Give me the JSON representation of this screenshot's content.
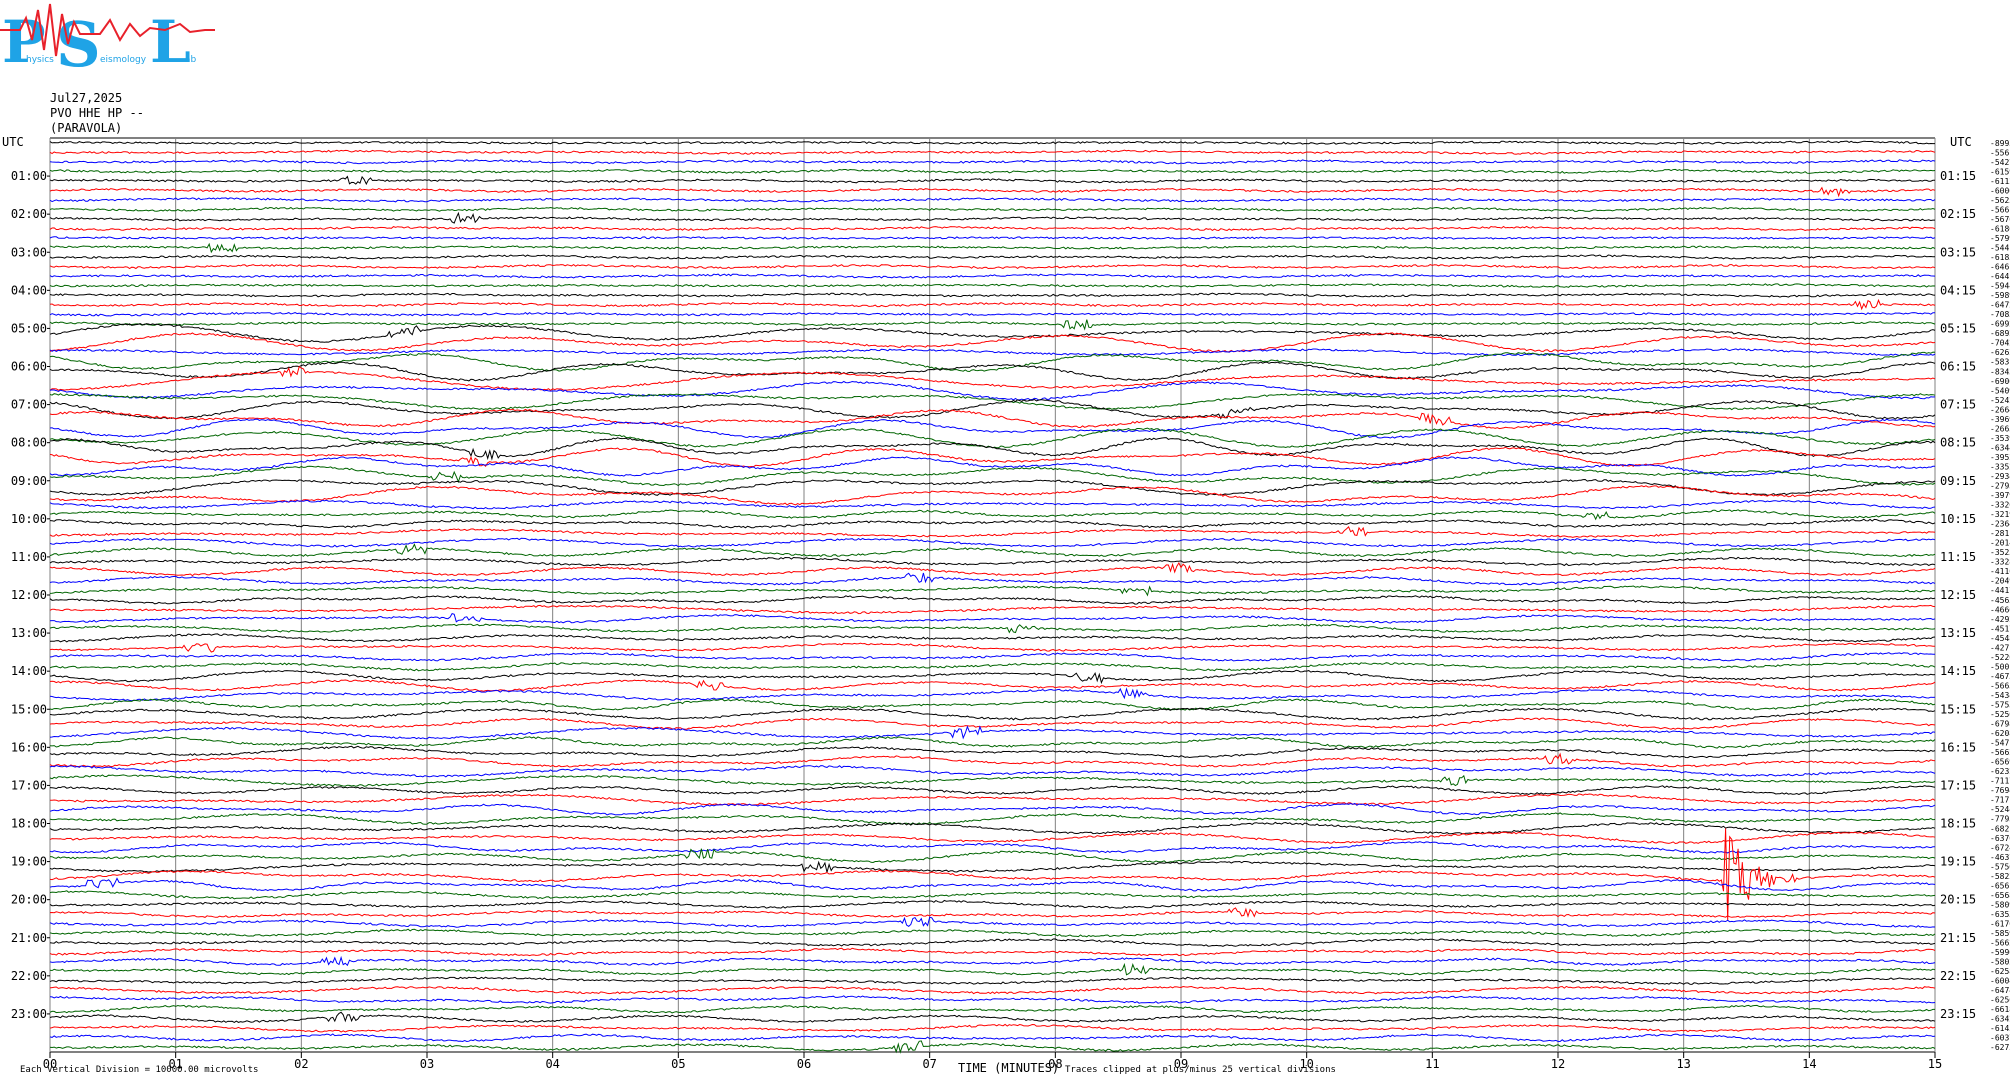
{
  "logo": {
    "letters": [
      "P",
      "S",
      "L"
    ],
    "words": [
      "hysics",
      "eismology",
      "ab"
    ],
    "colors": {
      "letters": "#1fa3e6",
      "seismo": "#e8212b"
    }
  },
  "header": {
    "date": "Jul27,2025",
    "station": "PVO HHE HP --",
    "location": "(PARAVOLA)"
  },
  "footer": {
    "scale_note": "Each Vertical Division = 10000.00 microvolts",
    "xlabel": "TIME (MINUTES)",
    "clip_note": "Traces clipped at plus/minus 25 vertical divisions"
  },
  "chart_data": {
    "type": "line",
    "title": "",
    "xlabel": "TIME (MINUTES)",
    "xlim": [
      0,
      15
    ],
    "x_ticks": [
      "00",
      "01",
      "02",
      "03",
      "04",
      "05",
      "06",
      "07",
      "08",
      "09",
      "10",
      "11",
      "12",
      "13",
      "14",
      "15"
    ],
    "left_axis_label": "UTC",
    "right_axis_label": "UTC",
    "left_ticks": [
      "01:00",
      "02:00",
      "03:00",
      "04:00",
      "05:00",
      "06:00",
      "07:00",
      "08:00",
      "09:00",
      "10:00",
      "11:00",
      "12:00",
      "13:00",
      "14:00",
      "15:00",
      "16:00",
      "17:00",
      "18:00",
      "19:00",
      "20:00",
      "21:00",
      "22:00",
      "23:00"
    ],
    "right_ticks": [
      "01:15",
      "02:15",
      "03:15",
      "04:15",
      "05:15",
      "06:15",
      "07:15",
      "08:15",
      "09:15",
      "10:15",
      "11:15",
      "12:15",
      "13:15",
      "14:15",
      "15:15",
      "16:15",
      "17:15",
      "18:15",
      "19:15",
      "20:15",
      "21:15",
      "22:15",
      "23:15"
    ],
    "trace_colors": [
      "#000000",
      "#ff0000",
      "#0000ff",
      "#006400"
    ],
    "grid": true,
    "trace_offsets": [
      "-8993",
      "-5561",
      "-5427",
      "-6159",
      "-6112",
      "-6006",
      "-5625",
      "-5661",
      "-5676",
      "-6186",
      "-5799",
      "-5441",
      "-6183",
      "-6461",
      "-6441",
      "-5944",
      "-5989",
      "-6472",
      "-7083",
      "-6992",
      "-6892",
      "-7042",
      "-6262",
      "-5831",
      "-8343",
      "-6906",
      "-5409",
      "-5242",
      "-2664",
      "-3969",
      "-2665",
      "-3539",
      "-6344",
      "-3952",
      "-3352",
      "-2934",
      "-2795",
      "-3979",
      "-3326",
      "-3219",
      "-2364",
      "-2811",
      "-2014",
      "-3523",
      "-3328",
      "-4110",
      "-2049",
      "-4417",
      "-4565",
      "-4666",
      "-4292",
      "-4517",
      "-4548",
      "-4271",
      "-5226",
      "-5001",
      "-4673",
      "-5665",
      "-5434",
      "-5753",
      "-5250",
      "-6798",
      "-6208",
      "-5471",
      "-5662",
      "-6569",
      "-6232",
      "-7117",
      "-7694",
      "-7171",
      "-5244",
      "-7795",
      "-6821",
      "-6370",
      "-6724",
      "-4637",
      "-5750",
      "-5822",
      "-6561",
      "-6568",
      "-5809",
      "-6353",
      "-6170",
      "-5859",
      "-5662",
      "-5990",
      "-5802",
      "-6258",
      "-6004",
      "-6474",
      "-6256",
      "-6618",
      "-6342",
      "-6145",
      "-6037",
      "-6275"
    ]
  }
}
